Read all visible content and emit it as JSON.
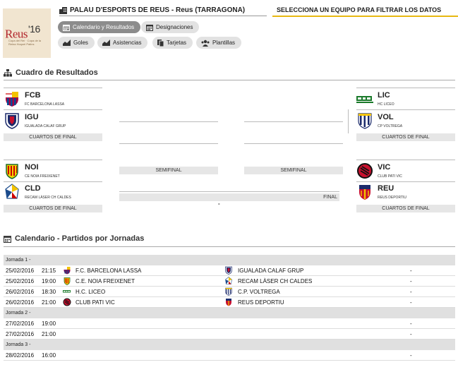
{
  "header": {
    "logo_text": "Reus'16",
    "logo_small": "Copa del Rei · Copa de la Reina Hoquei Patins",
    "venue": "PALAU D'ESPORTS DE REUS - Reus (TARRAGONA)",
    "filter_label": "SELECCIONA UN EQUIPO PARA FILTRAR LOS DATOS"
  },
  "tabs": {
    "calendario": "Calendario y Resultados",
    "designaciones": "Designaciones",
    "goles": "Goles",
    "asistencias": "Asistencias",
    "tarjetas": "Tarjetas",
    "plantillas": "Plantillas"
  },
  "bracket": {
    "title": "Cuadro de Resultados",
    "teams": {
      "fcb": {
        "code": "FCB",
        "name": "FC BARCELONA LASSA"
      },
      "igu": {
        "code": "IGU",
        "name": "IGUALADA CALAF GRUP"
      },
      "noi": {
        "code": "NOI",
        "name": "CE NOIA FREIXENET"
      },
      "cld": {
        "code": "CLD",
        "name": "RECAM LÀSER CH CALDES"
      },
      "lic": {
        "code": "LIC",
        "name": "HC LICEO"
      },
      "vol": {
        "code": "VOL",
        "name": "CP VOLTREGA"
      },
      "vic": {
        "code": "VIC",
        "name": "CLUB PATI VIC"
      },
      "reu": {
        "code": "REU",
        "name": "REUS DEPORTIU"
      }
    },
    "cuartos": "CUARTOS DE FINAL",
    "semifinal": "SEMIFINAL",
    "final": "FINAL",
    "final_result": "-"
  },
  "calendar": {
    "title": "Calendario - Partidos por Jornadas",
    "j1": "Jornada 1 -",
    "j2": "Jornada 2 -",
    "j3": "Jornada 3 -",
    "matches": [
      {
        "date": "25/02/2016",
        "time": "21:15",
        "home": "F.C. BARCELONA LASSA",
        "away": "IGUALADA CALAF GRUP",
        "result": "-"
      },
      {
        "date": "25/02/2016",
        "time": "19:00",
        "home": "C.E. NOIA FREIXENET",
        "away": "RECAM LÀSER CH CALDES",
        "result": "-"
      },
      {
        "date": "26/02/2016",
        "time": "18:30",
        "home": "H.C. LICEO",
        "away": "C.P. VOLTREGA",
        "result": "-"
      },
      {
        "date": "26/02/2016",
        "time": "21:00",
        "home": "CLUB PATI VIC",
        "away": "REUS DEPORTIU",
        "result": "-"
      },
      {
        "date": "27/02/2016",
        "time": "19:00",
        "result": "-"
      },
      {
        "date": "27/02/2016",
        "time": "21:00",
        "result": "-"
      },
      {
        "date": "28/02/2016",
        "time": "16:00",
        "result": "-"
      }
    ]
  },
  "colors": {
    "accent": "#e7b812",
    "active_tab": "#8c8c8c",
    "tab": "#e2e2e2",
    "logo_red": "#b2262c"
  }
}
